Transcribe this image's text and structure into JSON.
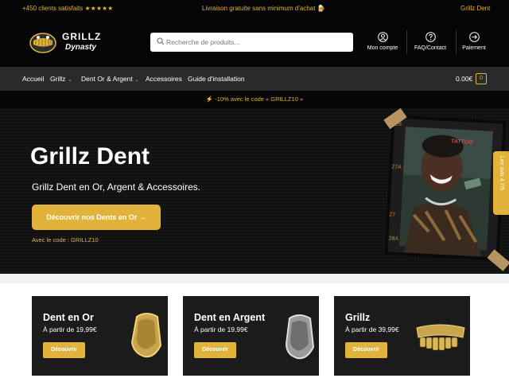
{
  "topbar": {
    "left": "+450 clients satisfaits ★★★★★",
    "center": "Livraison gratuite sans minimum d'achat 🍺",
    "right": "Grillz Dent"
  },
  "header": {
    "logo_line1": "GRILLZ",
    "logo_line2": "Dynasty",
    "search_placeholder": "Recherche de produits...",
    "account_label": "Mon compte",
    "faq_label": "FAQ/Contact",
    "payment_label": "Paiement"
  },
  "nav": {
    "items": [
      {
        "label": "Accueil",
        "dropdown": false
      },
      {
        "label": "Grillz",
        "dropdown": true
      },
      {
        "label": "Dent Or & Argent",
        "dropdown": true
      },
      {
        "label": "Accessoires",
        "dropdown": false
      },
      {
        "label": "Guide d'installation",
        "dropdown": false
      }
    ],
    "cart_total": "0.00€",
    "cart_count": "0"
  },
  "promo": "⚡ -10% avec le code « GRILLZ10 »",
  "hero": {
    "title": "Grillz Dent",
    "subtitle": "Grillz Dent en Or, Argent & Accessoires.",
    "cta": "Découvrir nos Dents en Or →",
    "code_note": "Avec le code : GRILLZ10",
    "photo_text_top": "TATTOO",
    "film_numbers": [
      "27A",
      "28",
      "27",
      "28A"
    ],
    "badge": "Les avis 4.7/5"
  },
  "cards": [
    {
      "title": "Dent en Or",
      "price": "À partir de 19,99€",
      "button": "Découvrir"
    },
    {
      "title": "Dent en Argent",
      "price": "À partir de 19,99€",
      "button": "Découvrir"
    },
    {
      "title": "Grillz",
      "price": "À partir de 39,99€",
      "button": "Découvrir"
    }
  ],
  "colors": {
    "accent": "#e2b33a",
    "dark": "#050505",
    "nav": "#2a2a2a",
    "card": "#1b1b1b"
  }
}
